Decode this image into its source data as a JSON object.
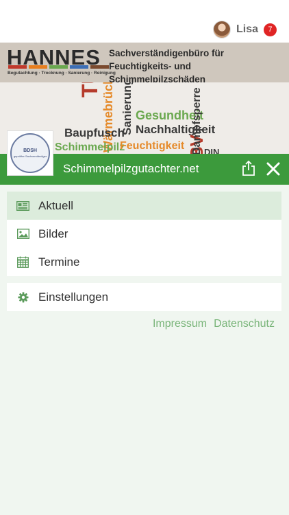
{
  "user": {
    "name": "Lisa",
    "notification_count": "7",
    "avatar_icon": "user-avatar"
  },
  "banner": {
    "brand_name": "HANNES",
    "brand_tagline": "Begutachtung · Trocknung · Sanierung · Reinigung",
    "title_line1": "Sachverständigenbüro für",
    "title_line2": "Feuchtigkeits- und Schimmelpilzschäden",
    "stripe_colors": [
      "#c0392b",
      "#e87e1e",
      "#6aa84f",
      "#3d6fb6",
      "#7b4a2e"
    ]
  },
  "word_cloud": {
    "words": [
      {
        "text": "TÜV",
        "color": "#b53b2b"
      },
      {
        "text": "Wärmebrücken",
        "color": "#e58a2a"
      },
      {
        "text": "Sanierung",
        "color": "#3a3a3a"
      },
      {
        "text": "Gesundheit",
        "color": "#6aa84f"
      },
      {
        "text": "Nachhaltigkeit",
        "color": "#3a3a3a"
      },
      {
        "text": "Baupfusch",
        "color": "#3a3a3a"
      },
      {
        "text": "Schimmelpilz",
        "color": "#6aa84f"
      },
      {
        "text": "Feuchtigkeit",
        "color": "#e58a2a"
      },
      {
        "text": "BV",
        "color": "#b53b2b"
      },
      {
        "text": "Dampfsperre",
        "color": "#3a3a3a"
      },
      {
        "text": "DIN",
        "color": "#3a3a3a"
      }
    ]
  },
  "logo": {
    "seal_text": "BDSH",
    "seal_sub": "geprüfter Sachverständiger"
  },
  "header": {
    "site_title": "Schimmelpilzgutachter.net",
    "share_icon": "share-icon",
    "close_icon": "close-icon",
    "color": "#3c9a3c"
  },
  "menu": {
    "items": [
      {
        "label": "Aktuell",
        "icon": "newspaper-icon",
        "active": true
      },
      {
        "label": "Bilder",
        "icon": "image-icon",
        "active": false
      },
      {
        "label": "Termine",
        "icon": "calendar-icon",
        "active": false
      }
    ],
    "settings": {
      "label": "Einstellungen",
      "icon": "gear-icon"
    }
  },
  "footer": {
    "impressum": "Impressum",
    "datenschutz": "Datenschutz"
  }
}
